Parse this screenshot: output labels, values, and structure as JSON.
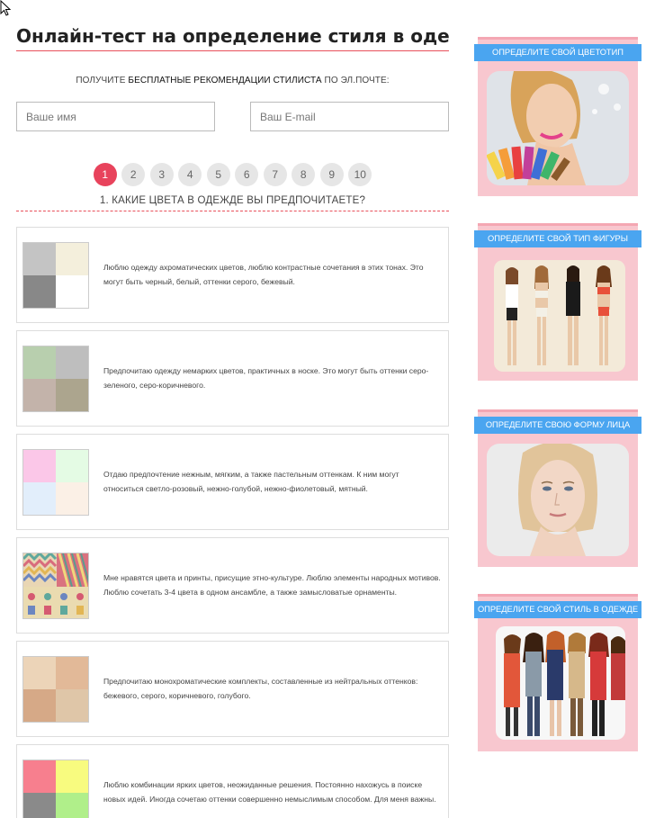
{
  "page": {
    "title": "Онлайн-тест на определение стиля в одежде"
  },
  "promo": {
    "text_before": "Получите ",
    "text_bold": "бесплатные рекомендации стилиста",
    "text_after": " по эл.почте:"
  },
  "form": {
    "name_placeholder": "Ваше имя",
    "email_placeholder": "Ваш E-mail"
  },
  "steps": [
    "1",
    "2",
    "3",
    "4",
    "5",
    "6",
    "7",
    "8",
    "9",
    "10"
  ],
  "question": {
    "title": "1. Какие цвета в одежде вы предпочитаете?"
  },
  "options": [
    {
      "text": "Люблю одежду ахроматических цветов, люблю контрастные сочетания в этих тонах. Это могут быть черный, белый, оттенки серого, бежевый.",
      "colors": [
        "#c4c4c4",
        "#f4efdc",
        "#888888",
        "#ffffff"
      ]
    },
    {
      "text": "Предпочитаю одежду немарких цветов, практичных в носке. Это могут быть оттенки серо-зеленого, серо-коричневого.",
      "colors": [
        "#b8cfae",
        "#bebebe",
        "#c3b3aa",
        "#aca58e"
      ]
    },
    {
      "text": "Отдаю предпочтение нежным, мягким, а также пастельным оттенкам. К ним могут относиться светло-розовый, нежно-голубой, нежно-фиолетовый, мятный.",
      "colors": [
        "#fbc7e8",
        "#e4fbe4",
        "#e2eefb",
        "#fbf0e6"
      ]
    },
    {
      "text": "Мне нравятся цвета и принты, присущие этно-культуре. Люблю элементы народных мотивов. Люблю сочетать 3-4 цвета в одном ансамбле, а также замысловатые орнаменты.",
      "colors": [
        "#9ec9b8",
        "#e07a8a",
        "#e6c76a",
        "#7a9ac9"
      ]
    },
    {
      "text": "Предпочитаю монохроматические комплекты, составленные из нейтральных оттенков: бежевого, серого, коричневого, голубого.",
      "colors": [
        "#ecd4b8",
        "#e2b998",
        "#d6a987",
        "#dfc6a8"
      ]
    },
    {
      "text": "Люблю комбинации ярких цветов, неожиданные решения. Постоянно нахожусь в поиске новых идей. Иногда сочетаю оттенки совершенно немыслимым способом. Для меня важны.",
      "colors": [
        "#f77f8e",
        "#f8fb7f",
        "#8a8a8a",
        "#b0ef8a"
      ]
    }
  ],
  "sidebar": [
    {
      "label": "Определите свой цветотип"
    },
    {
      "label": "Определите свой тип фигуры"
    },
    {
      "label": "Определите свою форму лица"
    },
    {
      "label": "Определите свой стиль в одежде"
    }
  ],
  "colors": {
    "accent": "#e8435c",
    "banner": "#4aa5f0",
    "card": "#f8c7cf"
  }
}
